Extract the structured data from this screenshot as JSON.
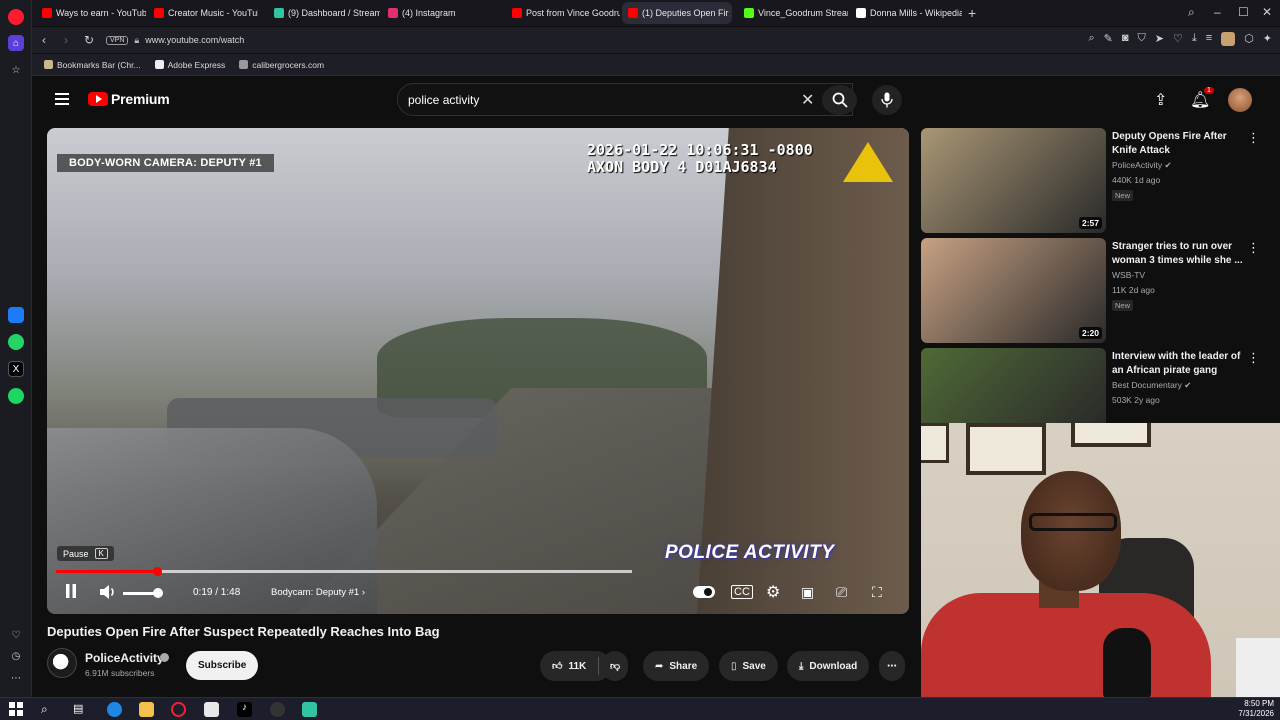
{
  "browser": {
    "tabs": [
      {
        "label": "Ways to earn - YouTube S",
        "color": "#ff0000",
        "active": false
      },
      {
        "label": "Creator Music - YouTube S",
        "color": "#ff0000",
        "active": false
      },
      {
        "label": "(9) Dashboard / Streamlab",
        "color": "#31c3a2",
        "active": false
      },
      {
        "label": "(4) Instagram",
        "color": "#e1306c",
        "active": false
      },
      {
        "label": "Post from Vince Goodrum",
        "color": "#ff0000",
        "active": false
      },
      {
        "label": "(1) Deputies Open Fir",
        "color": "#ff0000",
        "active": true
      },
      {
        "label": "Vince_Goodrum Stream -",
        "color": "#53fc18",
        "active": false
      },
      {
        "label": "Donna Mills - Wikipedia",
        "color": "#ffffff",
        "active": false
      }
    ],
    "vpn_label": "VPN",
    "url": "www.youtube.com/watch",
    "bookmarks": [
      {
        "label": "Bookmarks Bar (Chr..."
      },
      {
        "label": "Adobe Express"
      },
      {
        "label": "calibergrocers.com"
      }
    ]
  },
  "youtube": {
    "logo_text": "Premium",
    "search_query": "police activity",
    "notification_count": "1"
  },
  "player": {
    "cam_label": "BODY-WORN CAMERA: DEPUTY #1",
    "timestamp_line1": "2026-01-22 10:06:31 -0800",
    "timestamp_line2": "AXON BODY 4 D01AJ6834",
    "watermark": "POLICE ACTIVITY",
    "tooltip_label": "Pause",
    "tooltip_key": "K",
    "time_display": "0:19 / 1:48",
    "chapter": "Bodycam: Deputy #1",
    "progress_fraction": 0.176,
    "buffer_fraction": 1.0,
    "volume_fraction": 0.85
  },
  "video": {
    "title": "Deputies Open Fire After Suspect Repeatedly Reaches Into Bag",
    "channel": "PoliceActivity",
    "subscribers": "6.91M subscribers",
    "subscribe_label": "Subscribe",
    "likes": "11K",
    "share_label": "Share",
    "save_label": "Save",
    "download_label": "Download"
  },
  "recommendations": [
    {
      "title": "Deputy Opens Fire After Knife Attack",
      "channel": "PoliceActivity",
      "meta": "440K  1d ago",
      "badge": "New",
      "duration": "2:57",
      "thumb_color": "#a99775"
    },
    {
      "title": "Stranger tries to run over woman 3 times while she ...",
      "channel": "WSB-TV",
      "meta": "11K  2d ago",
      "badge": "New",
      "duration": "2:20",
      "thumb_color": "#c7a183"
    },
    {
      "title": "Interview with the leader of an African pirate gang",
      "channel": "Best Documentary",
      "meta": "503K  2y ago",
      "badge": "",
      "duration": "",
      "thumb_color": "#4f6a35"
    }
  ],
  "taskbar": {
    "time": "8:50 PM",
    "date": "7/31/2026"
  }
}
